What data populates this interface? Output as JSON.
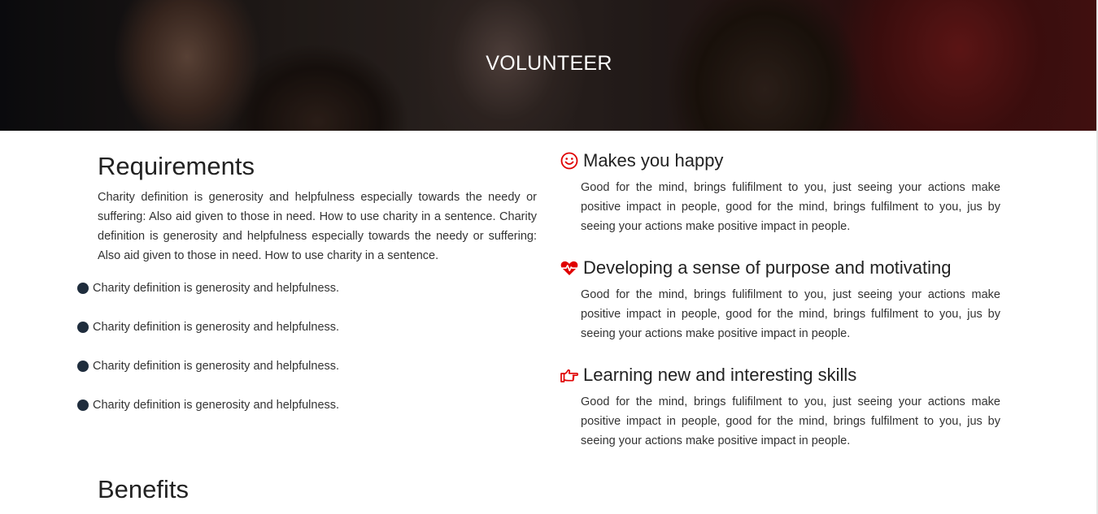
{
  "hero": {
    "title": "VOLUNTEER"
  },
  "requirements": {
    "heading": "Requirements",
    "text": "Charity definition is generosity and helpfulness especially towards the needy or suffering: Also aid given to those in need. How to use charity in a sentence. Charity definition is generosity and helpfulness especially towards the needy or suffering: Also aid given to those in need. How to use charity in a sentence.",
    "bullets": [
      "Charity definition is generosity and helpfulness.",
      "Charity definition is generosity and helpfulness.",
      "Charity definition is generosity and helpfulness.",
      "Charity definition is generosity and helpfulness."
    ]
  },
  "benefits": {
    "heading": "Benefits",
    "items": [
      {
        "icon": "smiley-icon",
        "title": "Makes you happy",
        "text": "Good for the mind, brings fulifilment to you, just seeing your actions make positive impact in people, good for the mind, brings fulfilment to you, jus by seeing your actions make positive impact in people."
      },
      {
        "icon": "heartbeat-icon",
        "title": "Developing a sense of purpose and motivating",
        "text": "Good for the mind, brings fulifilment to you, just seeing your actions make positive impact in people, good for the mind, brings fulfilment to you, jus by seeing your actions make positive impact in people."
      },
      {
        "icon": "hand-pointer-icon",
        "title": "Learning new and interesting skills",
        "text": "Good for the mind, brings fulifilment to you, just seeing your actions make positive impact in people, good for the mind, brings fulfilment to you, jus by seeing your actions make positive impact in people."
      }
    ]
  },
  "colors": {
    "accent": "#e00000",
    "bullet": "#1f2d3d",
    "text": "#333333"
  }
}
